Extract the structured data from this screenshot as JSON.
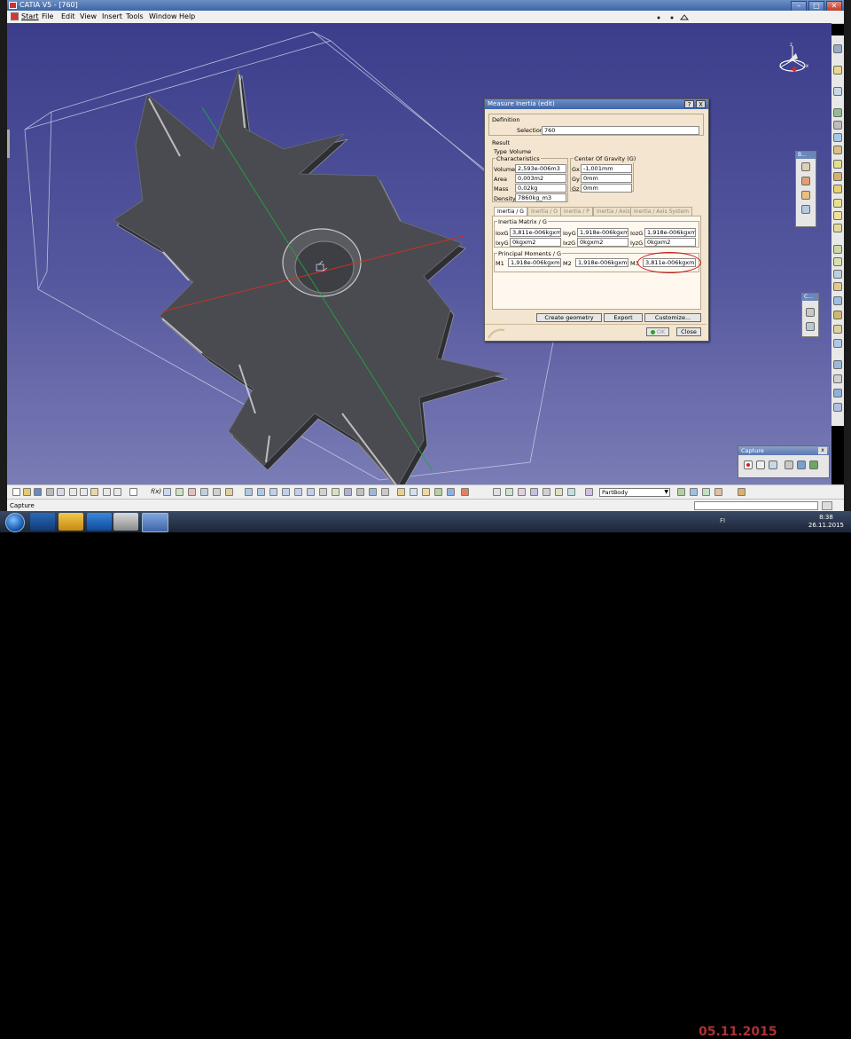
{
  "window": {
    "title": "CATIA V5 - [760]",
    "controls": {
      "minimize": "–",
      "maximize": "□",
      "close": "✕"
    }
  },
  "menu": {
    "items": [
      "Start",
      "File",
      "Edit",
      "View",
      "Insert",
      "Tools",
      "Window",
      "Help"
    ]
  },
  "dialog": {
    "title": "Measure Inertia (edit)",
    "help": "?",
    "close_x": "X",
    "definition_label": "Definition",
    "selection_label": "Selection :",
    "selection_value": "760",
    "result_label": "Result",
    "type_label": "Type :",
    "type_value": "Volume",
    "characteristics_label": "Characteristics",
    "characteristics": [
      {
        "label": "Volume",
        "value": "2,593e-006m3"
      },
      {
        "label": "Area",
        "value": "0,003m2"
      },
      {
        "label": "Mass",
        "value": "0,02kg"
      },
      {
        "label": "Density",
        "value": "7860kg_m3"
      }
    ],
    "cog_label": "Center Of Gravity (G)",
    "cog": [
      {
        "label": "Gx",
        "value": "-1,001mm"
      },
      {
        "label": "Gy",
        "value": "0mm"
      },
      {
        "label": "Gz",
        "value": "0mm"
      }
    ],
    "tabs": [
      "Inertia / G",
      "Inertia / O",
      "Inertia / P",
      "Inertia / Axis",
      "Inertia / Axis System"
    ],
    "active_tab": "Inertia / G",
    "matrix_label": "Inertia Matrix / G",
    "matrix": [
      [
        {
          "label": "IoxG",
          "value": "3,811e-006kgxm2"
        },
        {
          "label": "IoyG",
          "value": "1,918e-006kgxm2"
        },
        {
          "label": "IozG",
          "value": "1,918e-006kgxm2"
        }
      ],
      [
        {
          "label": "IxyG",
          "value": "0kgxm2"
        },
        {
          "label": "IxzG",
          "value": "0kgxm2"
        },
        {
          "label": "IyzG",
          "value": "0kgxm2"
        }
      ]
    ],
    "principal_label": "Principal Moments / G",
    "principal": [
      {
        "label": "M1",
        "value": "1,918e-006kgxm2"
      },
      {
        "label": "M2",
        "value": "1,918e-006kgxm2"
      },
      {
        "label": "M3",
        "value": "3,811e-006kgxm2"
      }
    ],
    "buttons": {
      "create_geometry": "Create geometry",
      "export": "Export",
      "customize": "Customize...",
      "ok": "OK",
      "close": "Close"
    }
  },
  "compass": {
    "z_label": "z",
    "x_label": "x"
  },
  "floating_toolbar": {
    "head": "B..."
  },
  "floating_toolbar2": {
    "head": "C..."
  },
  "capture_toolbar": {
    "title": "Capture",
    "close": "x"
  },
  "bottom_toolbar": {
    "partbody_value": "PartBody",
    "fog_label": "f(x)"
  },
  "status": {
    "text": "Capture"
  },
  "taskbar": {
    "watermark": "05.11.2015",
    "language": "FI",
    "time": "8:38",
    "date": "26.11.2015"
  },
  "colors": {
    "background_top": "#3c3e8c",
    "background_bottom": "#7a7cb6",
    "dialog_bg": "#f3e5cf",
    "highlight": "#c21a1a",
    "part_face": "#4a4b50",
    "x_axis": "#d0301e",
    "y_axis": "#22a53a"
  }
}
